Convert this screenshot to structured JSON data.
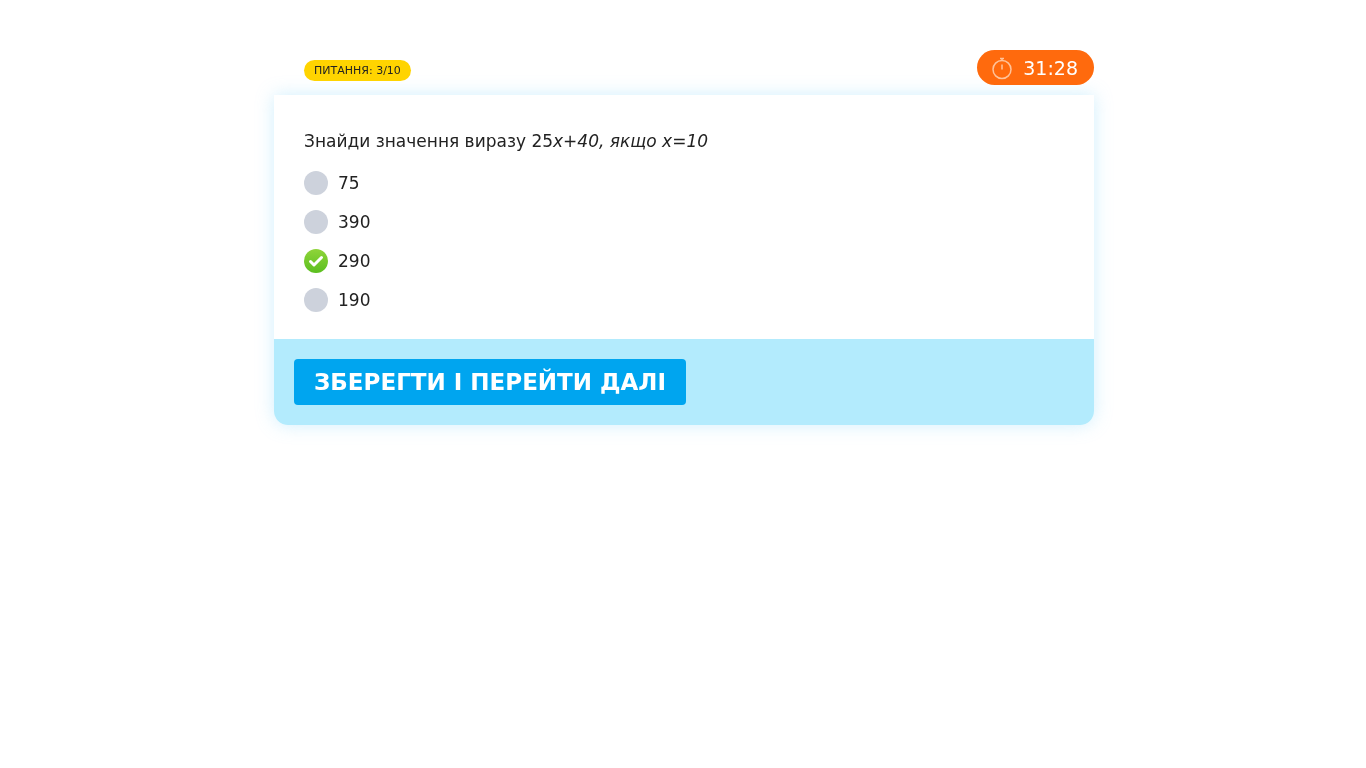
{
  "question_counter": "ПИТАННЯ: 3/10",
  "timer": "31:28",
  "question": {
    "text": "Знайди значення виразу 25",
    "italic_part": "x+40, якщо x=10"
  },
  "options": [
    {
      "label": "75",
      "selected": false
    },
    {
      "label": "390",
      "selected": false
    },
    {
      "label": "290",
      "selected": true
    },
    {
      "label": "190",
      "selected": false
    }
  ],
  "submit_button": "ЗБЕРЕГТИ І ПЕРЕЙТИ ДАЛІ"
}
